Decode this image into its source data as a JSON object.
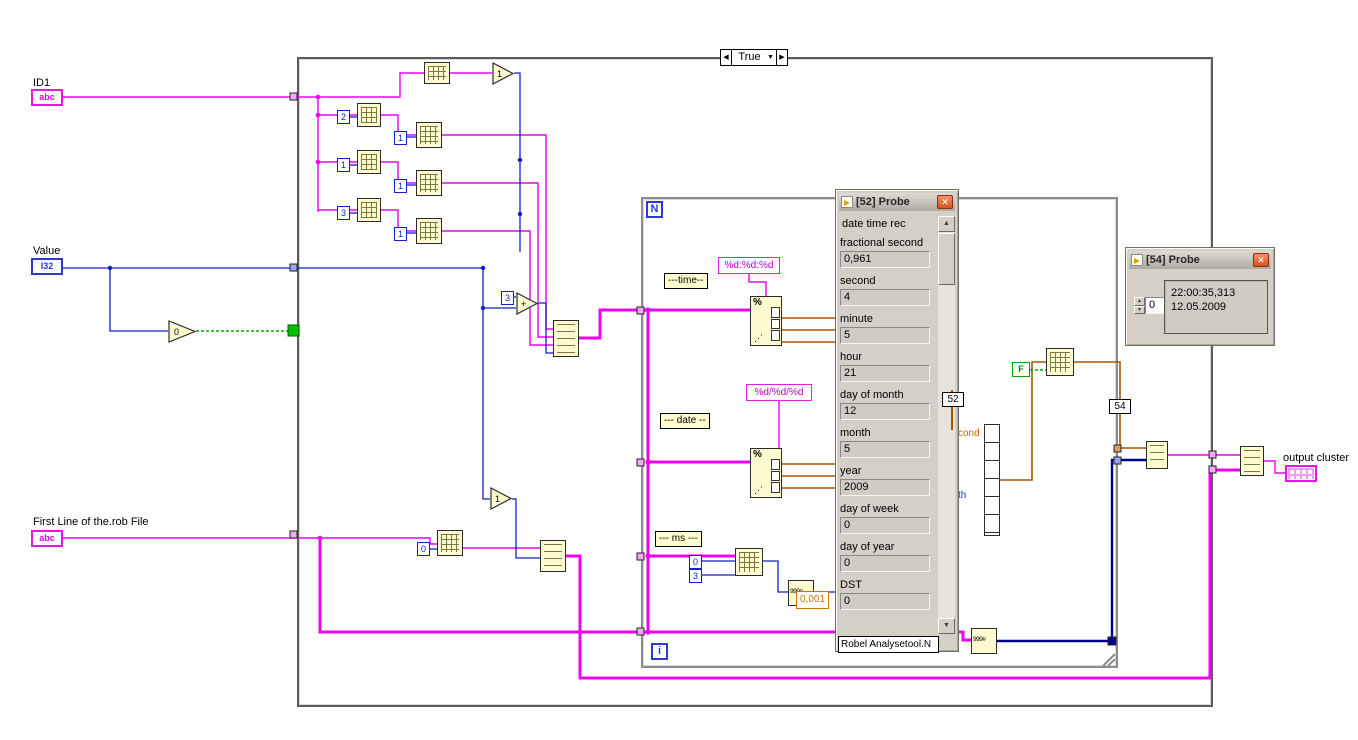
{
  "structures": {
    "case_selector_value": "True",
    "case_left_arrow": "◀",
    "case_right_arrow": "▶",
    "case_dropdown_arrow": "▼",
    "for_count_label": "N",
    "for_iterator_label": "i"
  },
  "terminals": {
    "id1_label": "ID1",
    "id1_glyph": "abc",
    "value_label": "Value",
    "value_glyph": "I32",
    "firstline_label": "First Line of the.rob File",
    "firstline_glyph": "abc",
    "output_label": "output cluster"
  },
  "constants": {
    "k2": "2",
    "k1a": "1",
    "k1b": "1",
    "k1c": "1",
    "k3a": "3",
    "k1d": "1",
    "k3b": "3",
    "k0a": "0",
    "k0b": "0",
    "k3c": "3",
    "ms_scale": "0,001",
    "bool_false": "F",
    "cmp_zero": "0"
  },
  "format_strings": {
    "time_fmt": "%d:%d:%d",
    "date_fmt": "%d/%d/%d"
  },
  "free_labels": {
    "time": "---time--",
    "date": "--- date --",
    "ms": "--- ms ---"
  },
  "probe_markers": {
    "p52": "52",
    "p54": "54"
  },
  "fragments": {
    "f1": "cond",
    "f2": "th"
  },
  "node_glyphs": {
    "scan_percent": "%",
    "scan_dots": "⋰",
    "to_number": "999#",
    "plus": "+",
    "one": "1"
  },
  "probe52": {
    "title": "[52] Probe",
    "close_glyph": "✕",
    "header": "date time rec",
    "fields": [
      {
        "label": "fractional second",
        "value": "0,961"
      },
      {
        "label": "second",
        "value": "4"
      },
      {
        "label": "minute",
        "value": "5"
      },
      {
        "label": "hour",
        "value": "21"
      },
      {
        "label": "day of month",
        "value": "12"
      },
      {
        "label": "month",
        "value": "5"
      },
      {
        "label": "year",
        "value": "2009"
      },
      {
        "label": "day of week",
        "value": "0"
      },
      {
        "label": "day of year",
        "value": "0"
      },
      {
        "label": "DST",
        "value": "0"
      }
    ],
    "footer": "Robel Analysetool.N",
    "scroll_up": "▲",
    "scroll_down": "▼"
  },
  "probe54": {
    "title": "[54] Probe",
    "close_glyph": "✕",
    "spin_up": "▲",
    "spin_down": "▼",
    "spinner_value": "0",
    "time_text": "22:00:35,313",
    "date_text": "12.05.2009"
  }
}
